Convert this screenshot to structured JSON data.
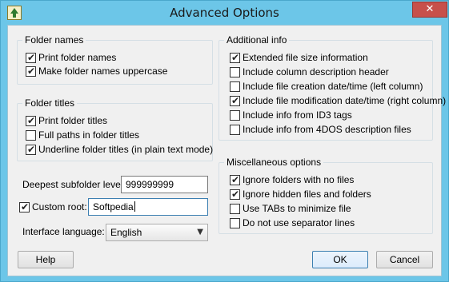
{
  "window": {
    "title": "Advanced Options",
    "close_glyph": "✕"
  },
  "folder_names": {
    "title": "Folder names",
    "items": [
      {
        "label": "Print folder names",
        "checked": true
      },
      {
        "label": "Make folder names uppercase",
        "checked": true
      }
    ]
  },
  "folder_titles": {
    "title": "Folder titles",
    "items": [
      {
        "label": "Print folder titles",
        "checked": true
      },
      {
        "label": "Full paths in folder titles",
        "checked": false
      },
      {
        "label": "Underline folder titles (in plain text mode)",
        "checked": true
      }
    ]
  },
  "deepest_level": {
    "label": "Deepest subfolder level:",
    "value": "999999999"
  },
  "custom_root": {
    "label": "Custom root:",
    "checked": true,
    "value": "Softpedia"
  },
  "interface_language": {
    "label": "Interface language:",
    "selected": "English"
  },
  "additional_info": {
    "title": "Additional info",
    "items": [
      {
        "label": "Extended file size information",
        "checked": true
      },
      {
        "label": "Include column description header",
        "checked": false
      },
      {
        "label": "Include file creation date/time (left column)",
        "checked": false
      },
      {
        "label": "Include file modification date/time (right column)",
        "checked": true
      },
      {
        "label": "Include info from ID3 tags",
        "checked": false
      },
      {
        "label": "Include info from 4DOS description files",
        "checked": false
      }
    ]
  },
  "misc": {
    "title": "Miscellaneous options",
    "items": [
      {
        "label": "Ignore folders with no files",
        "checked": true
      },
      {
        "label": "Ignore hidden files and folders",
        "checked": true
      },
      {
        "label": "Use TABs to minimize file",
        "checked": false
      },
      {
        "label": "Do not use separator lines",
        "checked": false
      }
    ]
  },
  "buttons": {
    "help": "Help",
    "ok": "OK",
    "cancel": "Cancel"
  },
  "check_glyph": "✔",
  "colors": {
    "titlebar": "#6cc6e8",
    "close": "#c7504b",
    "client": "#f0f0f0",
    "default_button_border": "#3c7fb1"
  }
}
